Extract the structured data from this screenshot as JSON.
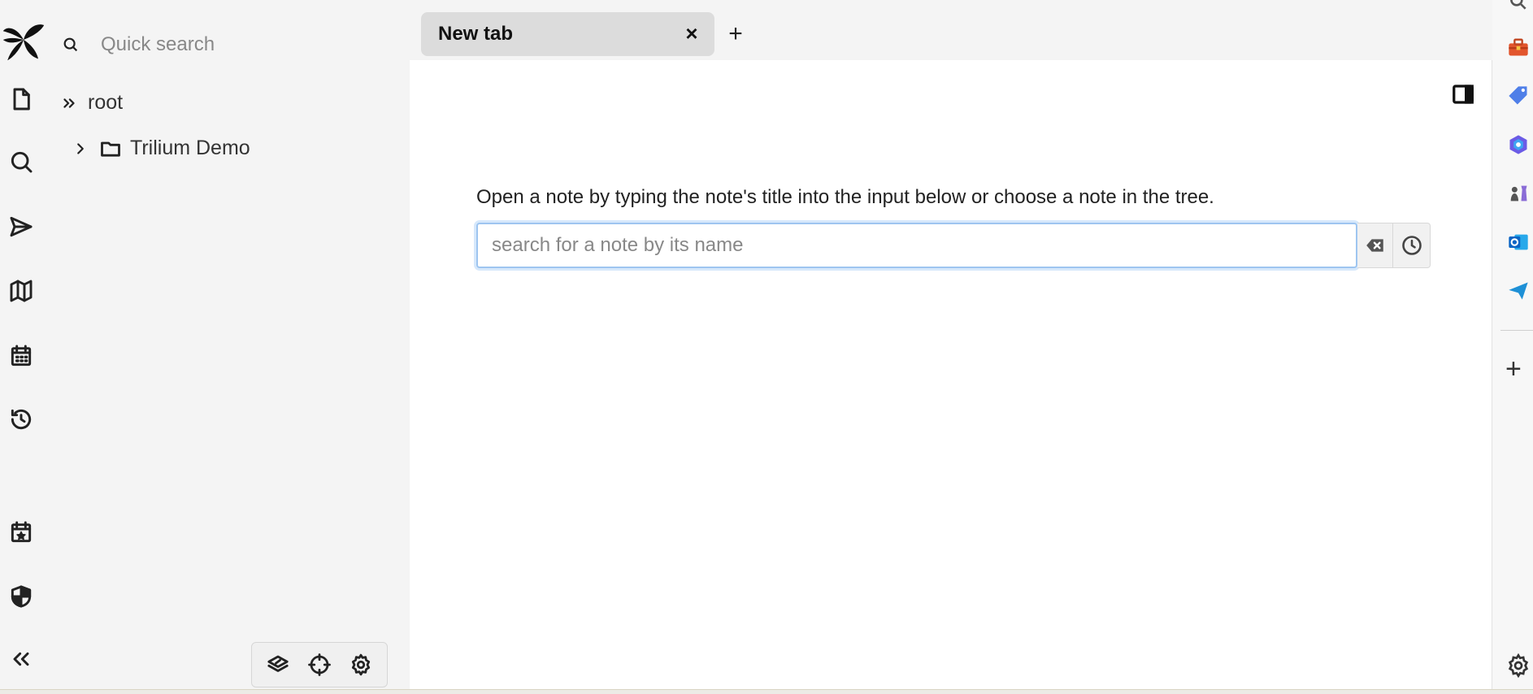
{
  "launcher": {
    "logo": "trilium-logo",
    "items": [
      {
        "name": "new-note",
        "icon": "file-icon"
      },
      {
        "name": "search",
        "icon": "search-icon"
      },
      {
        "name": "jump-to",
        "icon": "send-icon"
      },
      {
        "name": "note-map",
        "icon": "map-icon"
      },
      {
        "name": "calendar",
        "icon": "calendar-icon"
      },
      {
        "name": "recent-changes",
        "icon": "history-icon"
      },
      {
        "name": "today",
        "icon": "calendar-star-icon"
      },
      {
        "name": "protected-session",
        "icon": "shield-icon"
      },
      {
        "name": "collapse",
        "icon": "chevrons-left-icon"
      }
    ]
  },
  "tree": {
    "quick_search_placeholder": "Quick search",
    "root_label": "root",
    "items": [
      {
        "label": "Trilium Demo",
        "icon": "folder-icon",
        "expandable": true
      }
    ],
    "footer": [
      {
        "name": "collapse-tree",
        "icon": "layers-icon"
      },
      {
        "name": "scroll-to-active",
        "icon": "crosshair-icon"
      },
      {
        "name": "tree-settings",
        "icon": "gear-icon"
      }
    ]
  },
  "tabs": [
    {
      "title": "New tab",
      "close": "×"
    }
  ],
  "new_tab_label": "+",
  "main": {
    "prompt": "Open a note by typing the note's title into the input below or choose a note in the tree.",
    "search_placeholder": "search for a note by its name"
  },
  "right_strip": {
    "plus_label": "+",
    "icons": [
      "search-icon",
      "toolbox-icon",
      "tag-icon",
      "copilot-icon",
      "chess-icon",
      "outlook-icon",
      "telegram-icon",
      "gear-icon"
    ]
  },
  "colors": {
    "accent_focus": "#9ec5f0",
    "panel_bg": "#f4f4f4",
    "tab_bg": "#dcdcdc"
  }
}
